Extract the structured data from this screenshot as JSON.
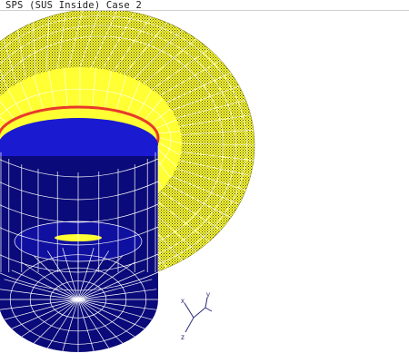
{
  "view": {
    "title": "SPS (SUS Inside) Case 2"
  },
  "colors": {
    "background": "#ffffff",
    "flange_yellow": "#ffff33",
    "flange_dots": "#2a2a2a",
    "inner_ring_red": "#e83a2a",
    "body_blue": "#1a1ad0",
    "body_navy": "#0a0a7a",
    "mesh_lines": "#ffffff",
    "axis_triad": "#2a2a7a"
  },
  "axes": {
    "x_label": "x",
    "y_label": "y",
    "z_label": "z"
  }
}
